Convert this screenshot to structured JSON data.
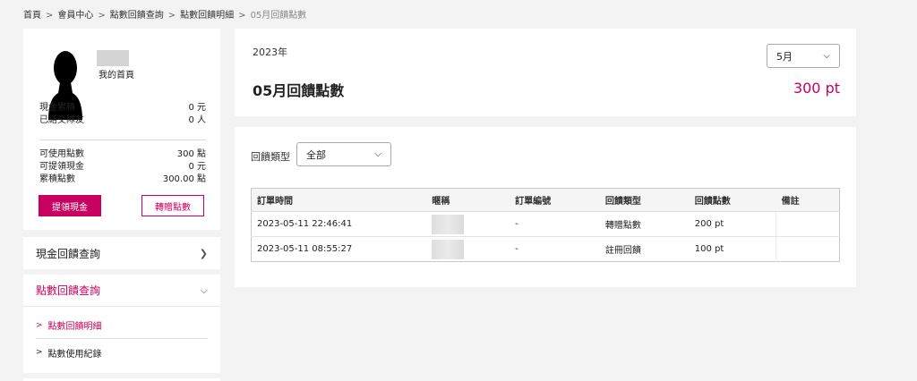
{
  "breadcrumb": [
    "首頁",
    "會員中心",
    "點數回饋查詢",
    "點數回饋明細",
    "05月回饋點數"
  ],
  "breadcrumb_sep": ">",
  "profile": {
    "home_link": "我的首頁",
    "stats_1": [
      {
        "label": "現金累積",
        "value": "0 元"
      },
      {
        "label": "已結交隊友",
        "value": "0 人"
      }
    ],
    "stats_2": [
      {
        "label": "可使用點數",
        "value": "300 點"
      },
      {
        "label": "可提領現金",
        "value": "0 元"
      },
      {
        "label": "累積點數",
        "value": "300.00 點"
      }
    ],
    "withdraw_label": "提領現金",
    "transfer_label": "轉贈點數"
  },
  "menu": {
    "cash_query": "現金回饋查詢",
    "points_query": "點數回饋查詢",
    "sub_items": [
      "點數回饋明細",
      "點數使用紀錄"
    ]
  },
  "summary": {
    "year": "2023年",
    "month_selected": "5月",
    "title": "05月回饋點數",
    "total": "300 pt"
  },
  "filter": {
    "label": "回饋類型",
    "selected": "全部"
  },
  "table": {
    "headers": [
      "訂單時間",
      "暱稱",
      "訂單編號",
      "回饋類型",
      "回饋點數",
      "備註"
    ],
    "rows": [
      [
        "2023-05-11 22:46:41",
        "",
        "-",
        "轉贈點數",
        "200 pt",
        ""
      ],
      [
        "2023-05-11 08:55:27",
        "",
        "-",
        "註冊回饋",
        "100 pt",
        ""
      ]
    ]
  },
  "colors": {
    "accent": "#c8005f"
  }
}
